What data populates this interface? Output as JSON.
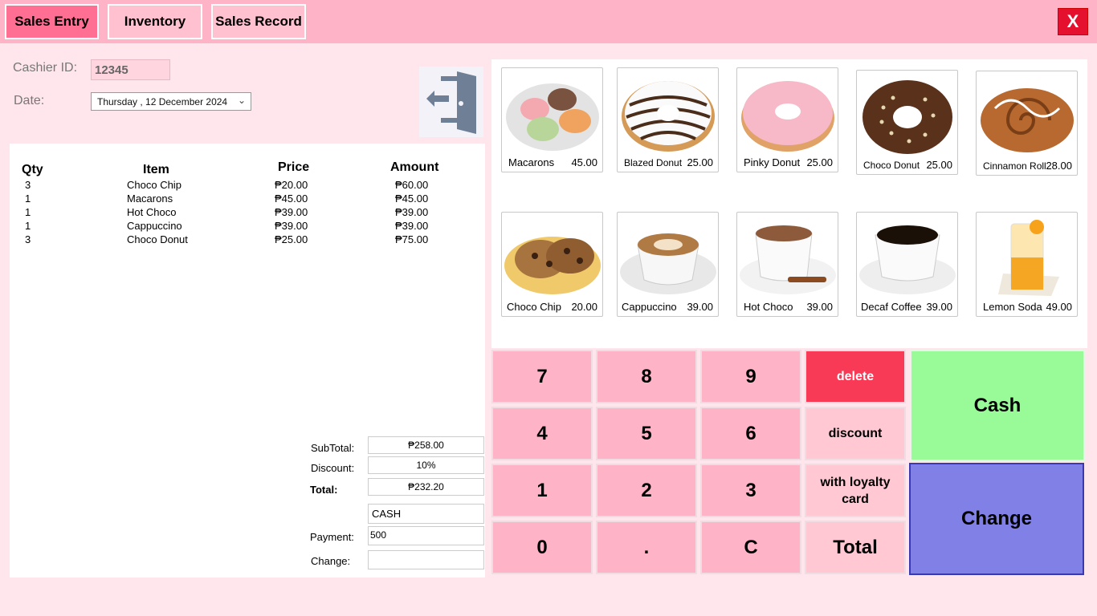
{
  "tabs": [
    {
      "label": "Sales Entry",
      "active": true
    },
    {
      "label": "Inventory",
      "active": false
    },
    {
      "label": "Sales Record",
      "active": false
    }
  ],
  "close_label": "X",
  "cashier": {
    "label": "Cashier ID:",
    "value": "12345"
  },
  "date": {
    "label": "Date:",
    "value": "Thursday  , 12 December 2024"
  },
  "logout_icon": "logout-door-icon",
  "receipt": {
    "headers": {
      "qty": "Qty",
      "item": "Item",
      "price": "Price",
      "amount": "Amount"
    },
    "rows": [
      {
        "qty": "3",
        "item": "Choco Chip",
        "price": "₱20.00",
        "amount": "₱60.00"
      },
      {
        "qty": "1",
        "item": "Macarons",
        "price": "₱45.00",
        "amount": "₱45.00"
      },
      {
        "qty": "1",
        "item": "Hot Choco",
        "price": "₱39.00",
        "amount": "₱39.00"
      },
      {
        "qty": "1",
        "item": "Cappuccino",
        "price": "₱39.00",
        "amount": "₱39.00"
      },
      {
        "qty": "3",
        "item": "Choco Donut",
        "price": "₱25.00",
        "amount": "₱75.00"
      }
    ]
  },
  "summary": {
    "subtotal_label": "SubTotal:",
    "subtotal": "₱258.00",
    "discount_label": "Discount:",
    "discount": "10%",
    "total_label": "Total:",
    "total": "₱232.20",
    "method": "CASH",
    "payment_label": "Payment:",
    "payment": "500",
    "change_label": "Change:",
    "change": ""
  },
  "products": [
    {
      "name": "Macarons",
      "price": "45.00",
      "icon": "macarons-image"
    },
    {
      "name": "Blazed Donut",
      "price": "25.00",
      "icon": "blazed-donut-image"
    },
    {
      "name": "Pinky Donut",
      "price": "25.00",
      "icon": "pinky-donut-image"
    },
    {
      "name": "Choco Donut",
      "price": "25.00",
      "icon": "choco-donut-image"
    },
    {
      "name": "Cinnamon Roll",
      "price": "28.00",
      "icon": "cinnamon-roll-image"
    },
    {
      "name": "Choco Chip",
      "price": "20.00",
      "icon": "choco-chip-image"
    },
    {
      "name": "Cappuccino",
      "price": "39.00",
      "icon": "cappuccino-image"
    },
    {
      "name": "Hot Choco",
      "price": "39.00",
      "icon": "hot-choco-image"
    },
    {
      "name": "Decaf Coffee",
      "price": "39.00",
      "icon": "decaf-coffee-image"
    },
    {
      "name": "Lemon Soda",
      "price": "49.00",
      "icon": "lemon-soda-image"
    }
  ],
  "keypad": {
    "k7": "7",
    "k8": "8",
    "k9": "9",
    "delete": "delete",
    "k4": "4",
    "k5": "5",
    "k6": "6",
    "discount": "discount",
    "k1": "1",
    "k2": "2",
    "k3": "3",
    "loyalty": "with loyalty card",
    "k0": "0",
    "dot": ".",
    "clear": "C",
    "total": "Total",
    "cash": "Cash",
    "change": "Change"
  },
  "colors": {
    "accent": "#ff6f94",
    "topbar": "#ffb3c6",
    "cash": "#98fb98",
    "change": "#8080e6",
    "delete": "#f83a56"
  }
}
